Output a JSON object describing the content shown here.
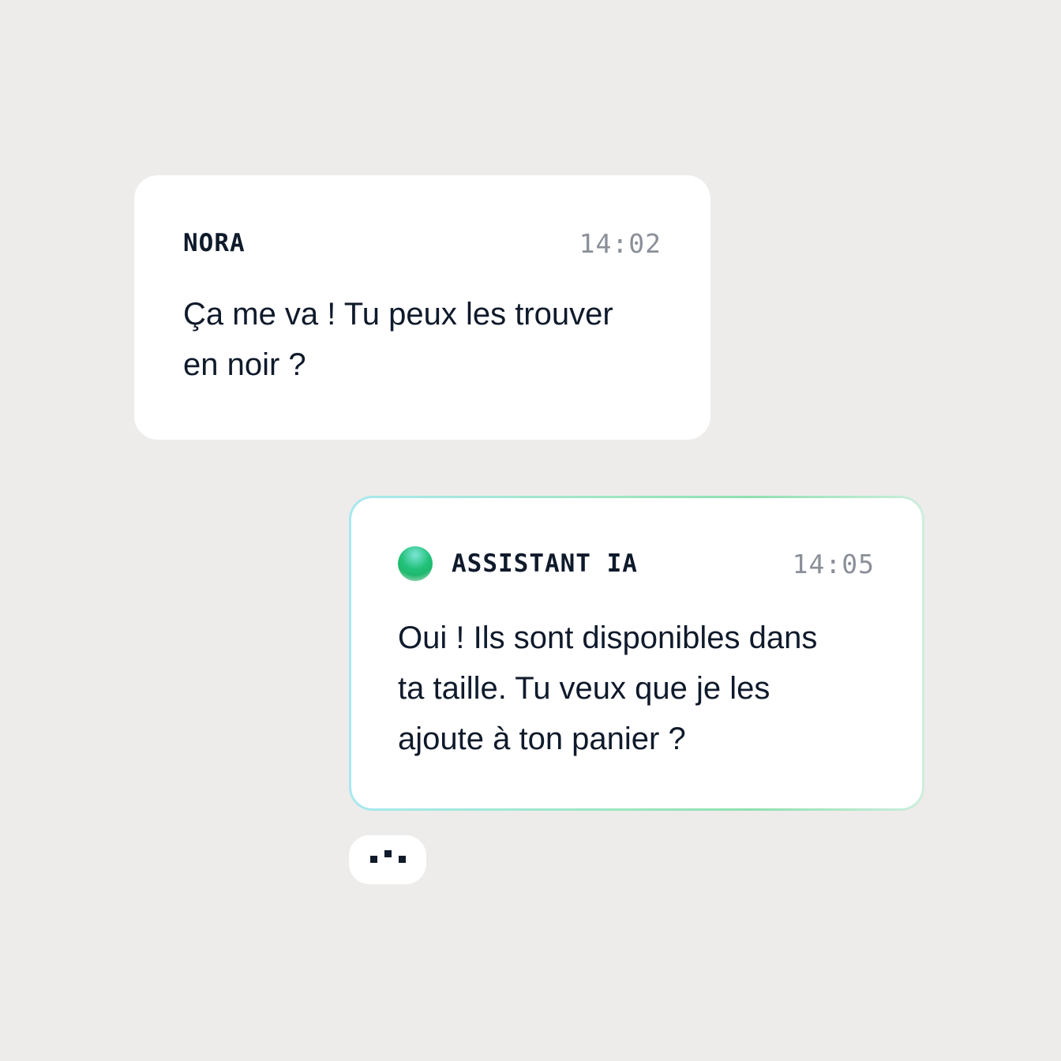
{
  "messages": [
    {
      "sender": "NORA",
      "time": "14:02",
      "text": "Ça me va ! Tu peux les trouver\nen noir ?"
    },
    {
      "sender": "ASSISTANT IA",
      "avatar_icon": "ai-gradient-dot-icon",
      "time": "14:05",
      "text": "Oui ! Ils sont disponibles dans\nta taille. Tu veux que je les\najoute à ton panier ?"
    }
  ],
  "typing_indicator": {
    "icon": "typing-dots-icon"
  },
  "colors": {
    "background": "#edecea",
    "bubble": "#ffffff",
    "text": "#0f1a2b",
    "time": "#8a8f98",
    "ai_accent": "#22c27a"
  }
}
